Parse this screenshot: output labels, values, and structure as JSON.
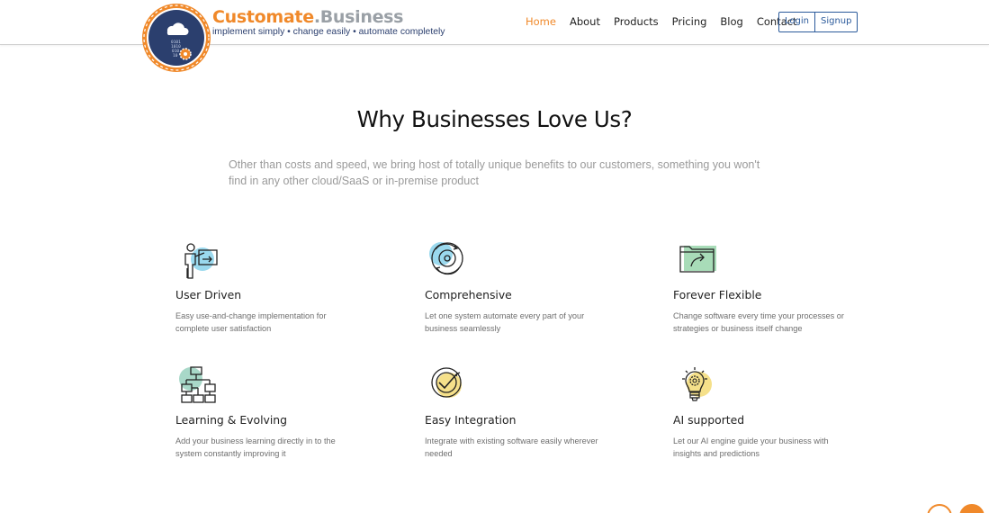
{
  "brand": {
    "name_part1": "Customate",
    "name_part2": ".Business",
    "tagline": "implement simply • change easily • automate completely",
    "logo_digits": "0101\n1010\n010\n10"
  },
  "nav": {
    "items": [
      {
        "label": "Home",
        "active": true
      },
      {
        "label": "About",
        "active": false
      },
      {
        "label": "Products",
        "active": false
      },
      {
        "label": "Pricing",
        "active": false
      },
      {
        "label": "Blog",
        "active": false
      },
      {
        "label": "Contact",
        "active": false
      }
    ],
    "login_label": "Login",
    "signup_label": "Signup"
  },
  "section": {
    "title": "Why Businesses Love Us?",
    "description": "Other than costs and speed, we bring host of totally unique benefits to our customers, something you won't find in any other cloud/SaaS or in-premise product"
  },
  "features": [
    {
      "title": "User Driven",
      "desc": "Easy use-and-change implementation for complete user satisfaction",
      "icon": "presenter-icon",
      "accent": "#9ad9ee"
    },
    {
      "title": "Comprehensive",
      "desc": "Let one system automate every part of your business seamlessly",
      "icon": "cycle-target-icon",
      "accent": "#9ad9ee"
    },
    {
      "title": "Forever Flexible",
      "desc": "Change software every time your processes or strategies or business itself change",
      "icon": "folder-share-icon",
      "accent": "#a8dcb8"
    },
    {
      "title": "Learning & Evolving",
      "desc": "Add your business learning directly in to the system constantly improving it",
      "icon": "hierarchy-icon",
      "accent": "#a8d8c8"
    },
    {
      "title": "Easy Integration",
      "desc": "Integrate with existing software easily wherever needed",
      "icon": "check-target-icon",
      "accent": "#f5e08a"
    },
    {
      "title": "AI supported",
      "desc": "Let our AI engine guide your business with insights and predictions",
      "icon": "bulb-gear-icon",
      "accent": "#f5e08a"
    }
  ],
  "colors": {
    "accent": "#f0892a",
    "navy": "#2b3f6e",
    "link_blue": "#2b5a9b"
  }
}
